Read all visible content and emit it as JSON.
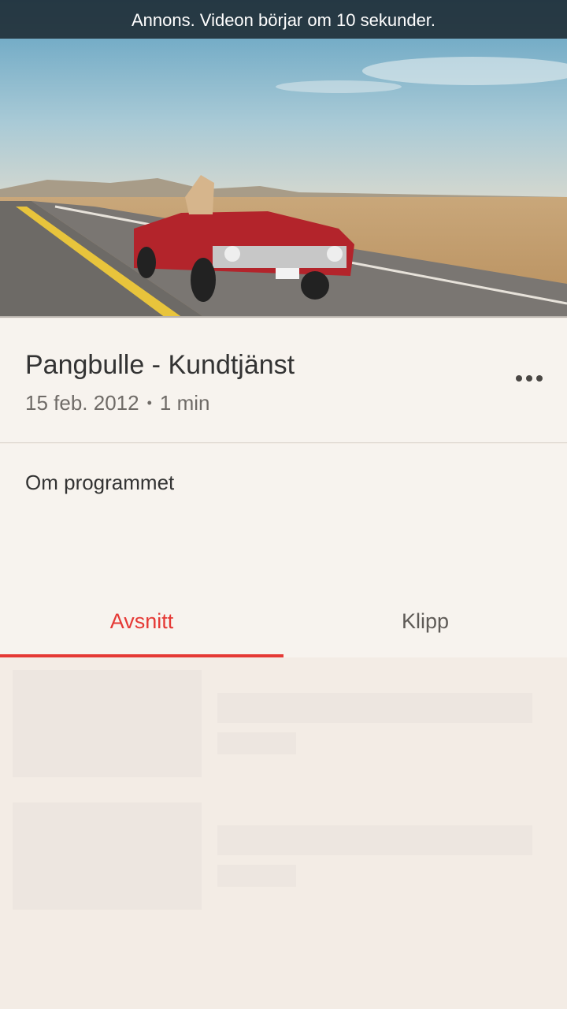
{
  "player": {
    "ad_notice": "Annons. Videon börjar om 10 sekunder.",
    "progress": 0
  },
  "program": {
    "title": "Pangbulle - Kundtjänst",
    "date": "15 feb. 2012",
    "separator": "•",
    "duration": "1 min",
    "more_icon": "more-horizontal-icon"
  },
  "about": {
    "label": "Om programmet"
  },
  "tabs": [
    {
      "label": "Avsnitt",
      "active": true
    },
    {
      "label": "Klipp",
      "active": false
    }
  ],
  "colors": {
    "accent": "#e53935",
    "background": "#f3ece5",
    "card": "#f7f3ee",
    "skeleton": "#ede6e0"
  }
}
